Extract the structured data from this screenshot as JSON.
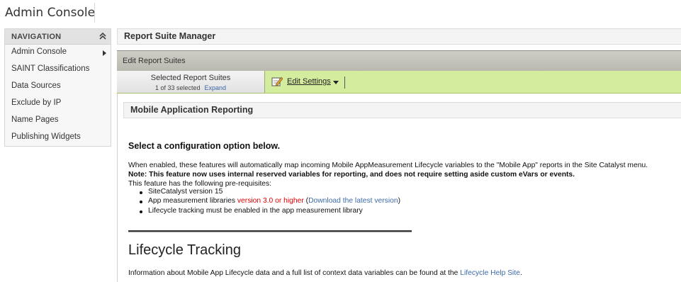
{
  "app": {
    "title": "Admin Console"
  },
  "sidebar": {
    "header": "NAVIGATION",
    "items": [
      {
        "label": "Admin Console"
      },
      {
        "label": "SAINT Classifications"
      },
      {
        "label": "Data Sources"
      },
      {
        "label": "Exclude by IP"
      },
      {
        "label": "Name Pages"
      },
      {
        "label": "Publishing Widgets"
      }
    ]
  },
  "main": {
    "title": "Report Suite Manager",
    "edit_bar_label": "Edit Report Suites",
    "selected": {
      "title": "Selected Report Suites",
      "count": "1 of 33 selected",
      "expand": "Expand"
    },
    "edit_settings": "Edit Settings",
    "section_title": "Mobile Application Reporting",
    "config_heading": "Select a configuration option below.",
    "para1": "When enabled, these features will automatically map incoming Mobile AppMeasurement Lifecycle variables to the \"Mobile App\" reports in the Site Catalyst menu.",
    "note": "Note: This feature now uses internal reserved variables for reporting, and does not require setting aside custom eVars or events.",
    "prereq_intro": "This feature has the following pre-requisites:",
    "bullets": {
      "b1": "SiteCatalyst version 15",
      "b2_prefix": "App measurement libraries ",
      "b2_red": "version 3.0 or higher",
      "b2_open": " (",
      "b2_link": "Download the latest version",
      "b2_close": ")",
      "b3": "Lifecycle tracking must be enabled in the app measurement library"
    },
    "lifecycle_heading": "Lifecycle Tracking",
    "info_text": "Information about Mobile App Lifecycle data and a full list of context data variables can be found at the ",
    "info_link": "Lifecycle Help Site",
    "info_end": "."
  },
  "colors": {
    "green_bar": "#d4ec9e",
    "link": "#3b6aa8",
    "red": "#e00000"
  },
  "icons": {
    "nav_collapse": "double-chevron-up-icon",
    "submenu": "chevron-right-icon",
    "edit": "edit-pencil-icon",
    "dropdown": "caret-down-icon"
  }
}
